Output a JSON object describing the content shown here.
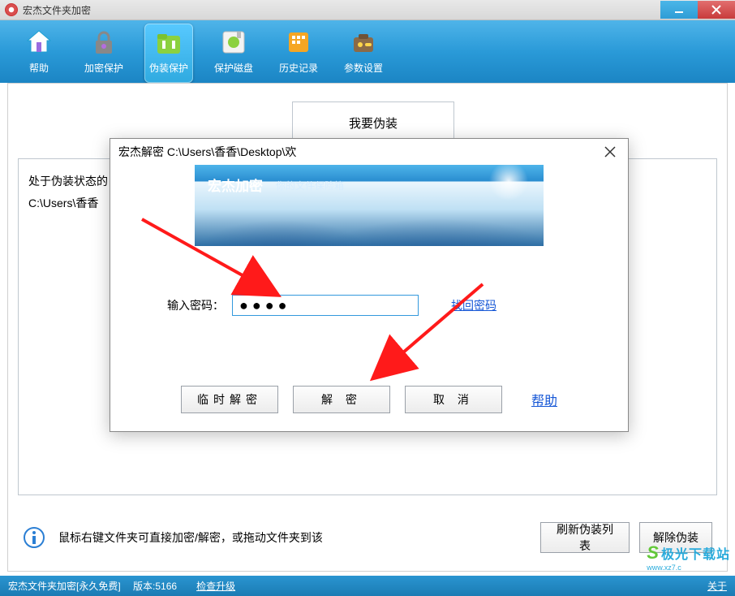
{
  "window": {
    "title": "宏杰文件夹加密",
    "min_tip": "_",
    "close_tip": "×"
  },
  "toolbar": {
    "items": [
      {
        "label": "帮助",
        "icon": "home-icon"
      },
      {
        "label": "加密保护",
        "icon": "lock-icon"
      },
      {
        "label": "伪装保护",
        "icon": "folder-icon",
        "active": true
      },
      {
        "label": "保护磁盘",
        "icon": "disk-icon"
      },
      {
        "label": "历史记录",
        "icon": "history-icon"
      },
      {
        "label": "参数设置",
        "icon": "settings-icon"
      }
    ]
  },
  "main": {
    "tab_label": "我要伪装",
    "list_header": "处于伪装状态的",
    "list_item0": "C:\\Users\\香香",
    "hint_text": "鼠标右键文件夹可直接加密/解密，或拖动文件夹到该",
    "refresh_btn": "刷新伪装列表",
    "remove_btn": "解除伪装"
  },
  "dialog": {
    "title": "宏杰解密 C:\\Users\\香香\\Desktop\\欢",
    "banner_title": "宏杰加密",
    "banner_sub": "你的文件保险箱",
    "pw_label": "输入密码：",
    "pw_value": "●●●●",
    "retrieve": "找回密码",
    "temp_decrypt": "临时解密",
    "decrypt": "解  密",
    "cancel": "取  消",
    "help": "帮助"
  },
  "statusbar": {
    "app": "宏杰文件夹加密",
    "free": "[永久免费]",
    "version_label": "版本:",
    "version": "5166",
    "check_update": "检查升级",
    "about": "关于"
  },
  "watermark": {
    "name": "极光下载站",
    "sub": "www.xz7.c"
  }
}
